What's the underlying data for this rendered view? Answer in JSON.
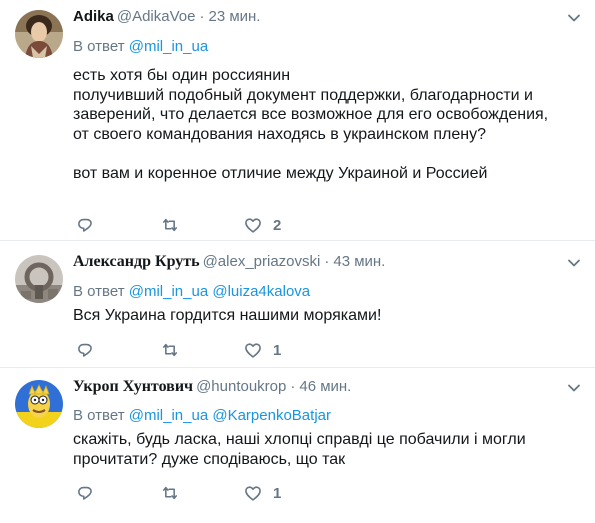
{
  "tweets": [
    {
      "fullname": "Adika",
      "username": "@AdikaVoe",
      "time": "23 мин.",
      "reply_prefix": "В ответ",
      "mentions": [
        "@mil_in_ua"
      ],
      "text": "есть хотя бы один россиянин\nполучивший подобный документ поддержки, благодарности и заверений, что делается все возможное для его освобождения,\nот своего командования находясь в украинском плену?\n\nвот вам и коренное отличие между Украиной и Россией",
      "like_count": "2"
    },
    {
      "fullname": "Александр Круть",
      "username": "@alex_priazovski",
      "time": "43 мин.",
      "reply_prefix": "В ответ",
      "mentions": [
        "@mil_in_ua",
        "@luiza4kalova"
      ],
      "text": "Вся Украина гордится нашими моряками!",
      "like_count": "1"
    },
    {
      "fullname": "Укроп Хунтович",
      "username": "@huntoukrop",
      "time": "46 мин.",
      "reply_prefix": "В ответ",
      "mentions": [
        "@mil_in_ua",
        "@KarpenkoBatjar"
      ],
      "text": "скажіть, будь ласка, наші хлопці справді це побачили і могли прочитати? дуже сподіваюсь, що так",
      "like_count": "1"
    }
  ],
  "separator": "·",
  "colors": {
    "link": "#1b95e0",
    "muted": "#657786",
    "text": "#14171a",
    "border": "#e6ecf0"
  },
  "icons": {
    "reply": "reply-icon",
    "retweet": "retweet-icon",
    "like": "heart-icon",
    "menu": "chevron-down-icon"
  }
}
